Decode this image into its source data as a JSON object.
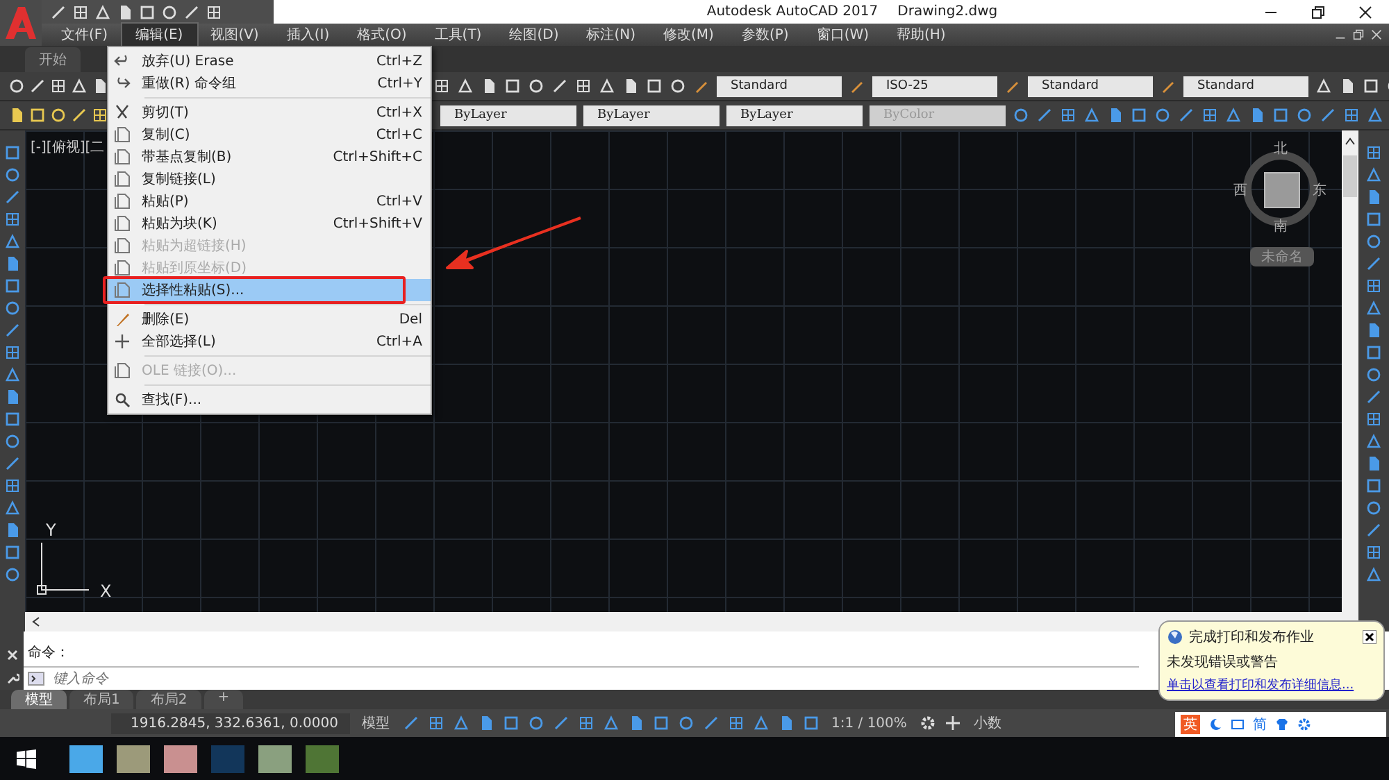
{
  "title": {
    "app": "Autodesk AutoCAD 2017",
    "file": "Drawing2.dwg"
  },
  "menu_bar": [
    {
      "label": "文件(F)",
      "selected": false
    },
    {
      "label": "编辑(E)",
      "selected": true
    },
    {
      "label": "视图(V)",
      "selected": false
    },
    {
      "label": "插入(I)",
      "selected": false
    },
    {
      "label": "格式(O)",
      "selected": false
    },
    {
      "label": "工具(T)",
      "selected": false
    },
    {
      "label": "绘图(D)",
      "selected": false
    },
    {
      "label": "标注(N)",
      "selected": false
    },
    {
      "label": "修改(M)",
      "selected": false
    },
    {
      "label": "参数(P)",
      "selected": false
    },
    {
      "label": "窗口(W)",
      "selected": false
    },
    {
      "label": "帮助(H)",
      "selected": false
    }
  ],
  "tabs": [
    {
      "label": "开始"
    }
  ],
  "styles_toolbar": [
    "Standard",
    "ISO-25",
    "Standard",
    "Standard"
  ],
  "properties_toolbar": [
    {
      "value": "ByLayer",
      "disabled": false
    },
    {
      "value": "ByLayer",
      "disabled": false
    },
    {
      "value": "ByLayer",
      "disabled": false
    },
    {
      "value": "ByColor",
      "disabled": true
    }
  ],
  "viewport_label": "[-][俯视][二",
  "view_cube": {
    "north": "北",
    "south": "南",
    "west": "西",
    "east": "东",
    "wcs": "未命名"
  },
  "ucs": {
    "x": "X",
    "y": "Y"
  },
  "edit_menu": [
    {
      "kind": "item",
      "label": "放弃(U) Erase",
      "shortcut": "Ctrl+Z",
      "disabled": false,
      "selected": false
    },
    {
      "kind": "item",
      "label": "重做(R) 命令组",
      "shortcut": "Ctrl+Y",
      "disabled": false,
      "selected": false
    },
    {
      "kind": "separator"
    },
    {
      "kind": "item",
      "label": "剪切(T)",
      "shortcut": "Ctrl+X",
      "disabled": false,
      "selected": false
    },
    {
      "kind": "item",
      "label": "复制(C)",
      "shortcut": "Ctrl+C",
      "disabled": false,
      "selected": false
    },
    {
      "kind": "item",
      "label": "带基点复制(B)",
      "shortcut": "Ctrl+Shift+C",
      "disabled": false,
      "selected": false
    },
    {
      "kind": "item",
      "label": "复制链接(L)",
      "disabled": false,
      "selected": false
    },
    {
      "kind": "item",
      "label": "粘贴(P)",
      "shortcut": "Ctrl+V",
      "disabled": false,
      "selected": false
    },
    {
      "kind": "item",
      "label": "粘贴为块(K)",
      "shortcut": "Ctrl+Shift+V",
      "disabled": false,
      "selected": false
    },
    {
      "kind": "item",
      "label": "粘贴为超链接(H)",
      "disabled": true,
      "selected": false
    },
    {
      "kind": "item",
      "label": "粘贴到原坐标(D)",
      "disabled": true,
      "selected": false
    },
    {
      "kind": "item",
      "label": "选择性粘贴(S)...",
      "disabled": false,
      "selected": true
    },
    {
      "kind": "separator"
    },
    {
      "kind": "item",
      "label": "删除(E)",
      "shortcut": "Del",
      "disabled": false,
      "selected": false
    },
    {
      "kind": "item",
      "label": "全部选择(L)",
      "shortcut": "Ctrl+A",
      "disabled": false,
      "selected": false
    },
    {
      "kind": "separator"
    },
    {
      "kind": "item",
      "label": "OLE 链接(O)...",
      "disabled": true,
      "selected": false
    },
    {
      "kind": "separator"
    },
    {
      "kind": "item",
      "label": "查找(F)...",
      "disabled": false,
      "selected": false
    }
  ],
  "command": {
    "history": "命令：",
    "placeholder": "键入命令"
  },
  "layout_tabs": [
    {
      "label": "模型",
      "selected": true
    },
    {
      "label": "布局1",
      "selected": false
    },
    {
      "label": "布局2",
      "selected": false
    }
  ],
  "add_layout": "+",
  "status_bar": {
    "coordinates": "1916.2845, 332.6361, 0.0000",
    "space": "模型",
    "scale": "1:1 / 100%",
    "units": "小数"
  },
  "notification": {
    "title": "完成打印和发布作业",
    "message": "未发现错误或警告",
    "link": "单击以查看打印和发布详细信息..."
  },
  "ime": {
    "mode": "英",
    "charset": "简"
  }
}
